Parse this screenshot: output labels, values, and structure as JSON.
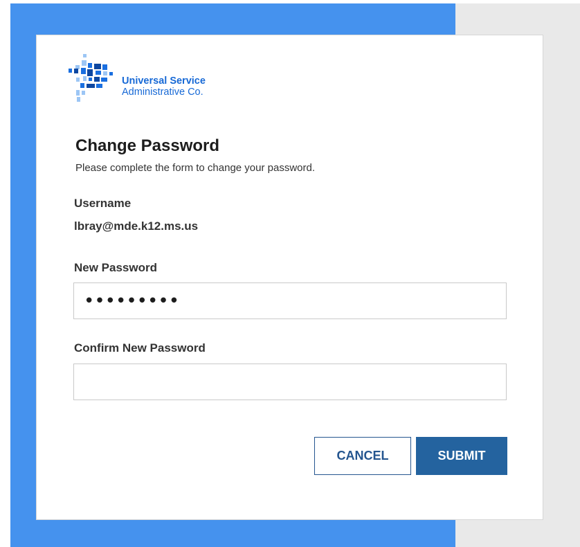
{
  "logo": {
    "line1": "Universal Service",
    "line2": "Administrative Co.",
    "brand_color": "#1769d6"
  },
  "form": {
    "title": "Change Password",
    "subtitle": "Please complete the form to change your password.",
    "username_label": "Username",
    "username_value": "lbray@mde.k12.ms.us",
    "new_password_label": "New Password",
    "new_password_value": "•••••••••",
    "confirm_password_label": "Confirm New Password",
    "confirm_password_value": ""
  },
  "buttons": {
    "cancel_label": "CANCEL",
    "submit_label": "SUBMIT"
  },
  "colors": {
    "background_blue": "#4592ee",
    "background_gray": "#e9e9e9",
    "button_primary": "#24639f",
    "button_outline": "#24558f"
  }
}
